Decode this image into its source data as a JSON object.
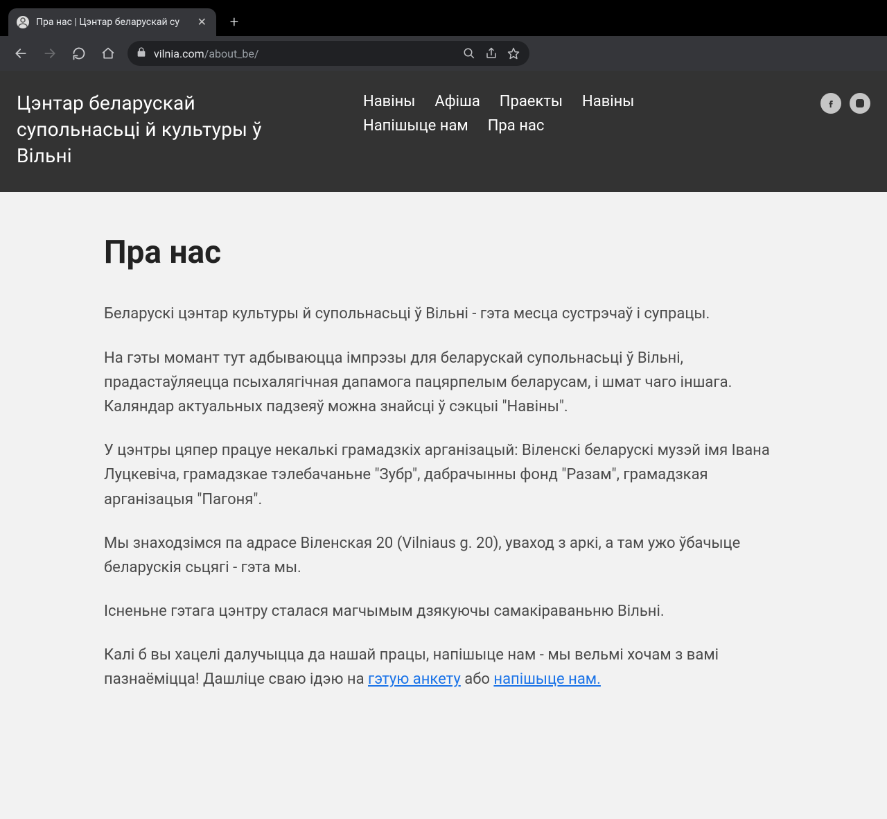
{
  "browser": {
    "tab_title": "Пра нас | Цэнтар беларускай су",
    "url_domain": "vilnia.com",
    "url_path": "/about_be/"
  },
  "header": {
    "brand": "Цэнтар беларускай супольнасьці й культуры ў Вільні",
    "nav": [
      "Навіны",
      "Афіша",
      "Праекты",
      "Навіны",
      "Напішыце нам",
      "Пра нас"
    ]
  },
  "page": {
    "title": "Пра нас",
    "p1": "Беларускі цэнтар культуры й супольнасьці ў Вільні - гэта месца сустрэчаў і супрацы.",
    "p2": "На гэты момант тут адбываюцца імпрэзы для беларускай супольнасьці ў Вільні, прадастаўляецца псыхалягічная дапамога пацярпелым беларусам, і шмат чаго іншага. Каляндар актуальных падзеяў можна знайсці ў сэкцыі \"Навіны\".",
    "p3": "У цэнтры цяпер працуе некалькі грамадзкіх арганізацый: Віленскі беларускі музэй імя Івана Луцкевіча, грамадзкае тэлебачаньне \"Зубр\", дабрачынны фонд \"Разам\", грамадзкая арганізацыя \"Пагоня\".",
    "p4": "Мы знаходзімся па адрасе Віленская 20 (Vilniaus g. 20), уваход з аркі, а там ужо ўбачыце беларускія сьцягі - гэта мы.",
    "p5": "Існеньне гэтага цэнтру сталася магчымым дзякуючы самакіраваньню Вільні.",
    "p6_a": "Калі б вы хацелі далучыцца да нашай працы, напішыце нам - мы вельмі хочам з вамі пазнаёміцца! Дашліце сваю ідэю на ",
    "p6_link1": "гэтую анкету",
    "p6_b": " або ",
    "p6_link2": "напішыце нам."
  }
}
